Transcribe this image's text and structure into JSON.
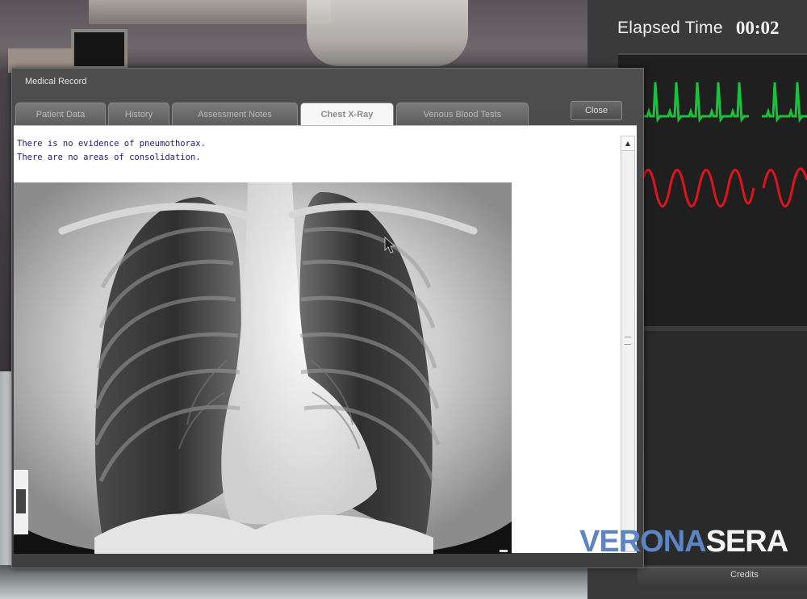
{
  "timer": {
    "label": "Elapsed Time",
    "value": "00:02"
  },
  "dialog": {
    "title": "Medical Record",
    "close_label": "Close",
    "tabs": [
      {
        "label": "Patient Data",
        "active": false
      },
      {
        "label": "History",
        "active": false
      },
      {
        "label": "Assessment Notes",
        "active": false
      },
      {
        "label": "Chest X-Ray",
        "active": true
      },
      {
        "label": "Venous Blood Tests",
        "active": false
      }
    ],
    "findings": [
      "There is no evidence of pneumothorax.",
      "There are no areas of consolidation."
    ]
  },
  "footer": {
    "credits_label": "Credits"
  },
  "watermark": {
    "part1": "VERONA",
    "part2": "SERA"
  },
  "colors": {
    "ecg_wave": "#19c23a",
    "resp_wave": "#e0141a",
    "watermark_blue": "#5d85c3"
  },
  "icons": {
    "scroll_up": "triangle-up-icon",
    "cursor": "mouse-pointer-icon"
  }
}
